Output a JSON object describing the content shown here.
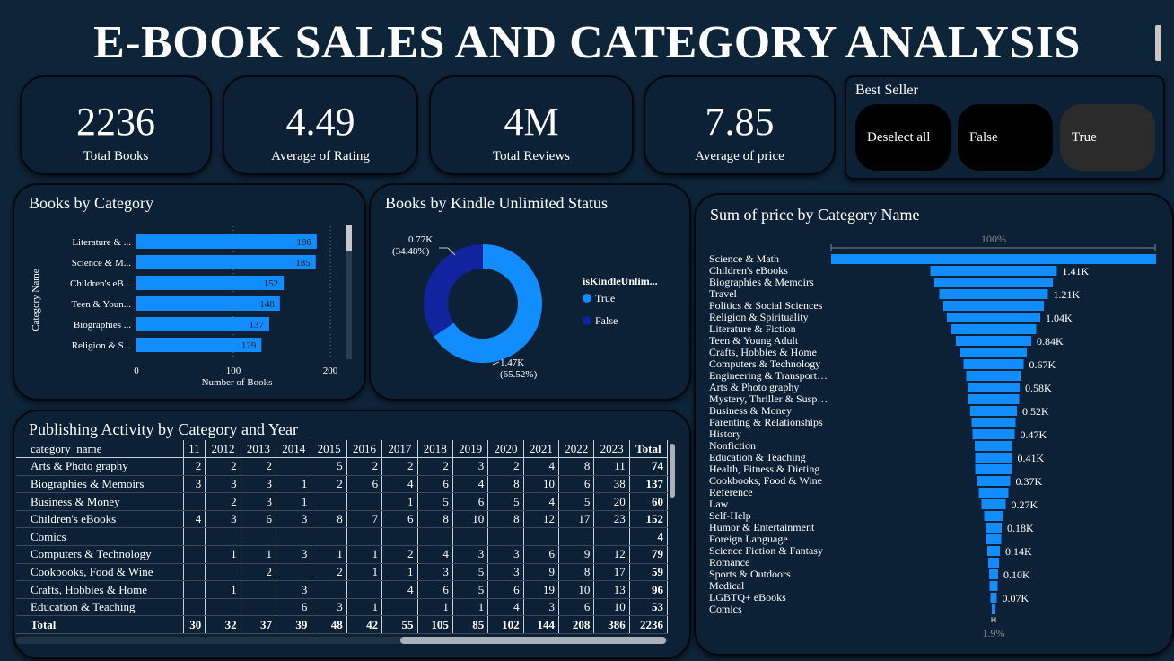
{
  "title": "E-BOOK SALES AND CATEGORY ANALYSIS",
  "kpis": [
    {
      "value": "2236",
      "label": "Total Books"
    },
    {
      "value": "4.49",
      "label": "Average of Rating"
    },
    {
      "value": "4M",
      "label": "Total Reviews"
    },
    {
      "value": "7.85",
      "label": "Average of price"
    }
  ],
  "best_seller": {
    "title": "Best Seller",
    "options": [
      "Deselect all",
      "False",
      "True"
    ],
    "selected": "True"
  },
  "colors": {
    "bar": "#118dff",
    "dark_bar": "#12239e",
    "background": "#0e2438"
  },
  "chart_data": [
    {
      "type": "bar",
      "orientation": "horizontal",
      "title": "Books by Category",
      "xlabel": "Number of Books",
      "ylabel": "Category Name",
      "categories": [
        "Literature & ...",
        "Science & M...",
        "Children's eB...",
        "Teen & Youn...",
        "Biographies ...",
        "Religion & S..."
      ],
      "values": [
        186,
        185,
        152,
        148,
        137,
        129
      ],
      "xticks": [
        "0",
        "100",
        "200"
      ],
      "xlim": [
        0,
        200
      ]
    },
    {
      "type": "pie",
      "donut": true,
      "title": "Books by Kindle Unlimited Status",
      "legend_title": "isKindleUnlim...",
      "slices": [
        {
          "name": "True",
          "value": 1.47,
          "label": "1.47K",
          "pct": "(65.52%)",
          "color": "#118dff"
        },
        {
          "name": "False",
          "value": 0.77,
          "label": "0.77K",
          "pct": "(34.48%)",
          "color": "#12239e"
        }
      ]
    },
    {
      "type": "bar",
      "subtype": "funnel",
      "title": "Sum of price by Category Name",
      "top_label": "100%",
      "bottom_label": "1.9%",
      "categories": [
        "Science & Math",
        "Children's eBooks",
        "Biographies & Memoirs",
        "Travel",
        "Politics & Social Sciences",
        "Religion & Spirituality",
        "Literature & Fiction",
        "Teen & Young Adult",
        "Crafts, Hobbies & Home",
        "Computers & Technology",
        "Engineering & Transport…",
        "Arts & Photo graphy",
        "Mystery, Thriller & Susp…",
        "Business & Money",
        "Parenting & Relationships",
        "History",
        "Nonfiction",
        "Education & Teaching",
        "Health, Fitness & Dieting",
        "Cookbooks, Food & Wine",
        "Reference",
        "Law",
        "Self-Help",
        "Humor & Entertainment",
        "Foreign Language",
        "Science Fiction & Fantasy",
        "Romance",
        "Sports & Outdoors",
        "Medical",
        "LGBTQ+ eBooks",
        "Comics"
      ],
      "values": [
        3.62,
        1.41,
        1.32,
        1.21,
        1.12,
        1.04,
        0.95,
        0.84,
        0.74,
        0.67,
        0.61,
        0.58,
        0.57,
        0.52,
        0.49,
        0.47,
        0.42,
        0.41,
        0.41,
        0.37,
        0.33,
        0.27,
        0.21,
        0.18,
        0.17,
        0.14,
        0.12,
        0.1,
        0.09,
        0.07,
        0.02
      ],
      "data_labels": [
        "",
        "1.41K",
        "",
        "1.21K",
        "",
        "1.04K",
        "",
        "0.84K",
        "",
        "0.67K",
        "",
        "0.58K",
        "",
        "0.52K",
        "",
        "0.47K",
        "",
        "0.41K",
        "",
        "0.37K",
        "",
        "0.27K",
        "",
        "0.18K",
        "",
        "0.14K",
        "",
        "0.10K",
        "",
        "0.07K",
        ""
      ]
    },
    {
      "type": "table",
      "title": "Publishing Activity by Category and Year",
      "columns": [
        "category_name",
        "11",
        "2012",
        "2013",
        "2014",
        "2015",
        "2016",
        "2017",
        "2018",
        "2019",
        "2020",
        "2021",
        "2022",
        "2023",
        "Total"
      ],
      "rows": [
        [
          "Arts & Photo graphy",
          "2",
          "2",
          "2",
          "",
          "5",
          "2",
          "2",
          "2",
          "3",
          "2",
          "4",
          "8",
          "11",
          "74"
        ],
        [
          "Biographies & Memoirs",
          "3",
          "3",
          "3",
          "1",
          "2",
          "6",
          "4",
          "6",
          "4",
          "8",
          "10",
          "6",
          "38",
          "137"
        ],
        [
          "Business & Money",
          "",
          "2",
          "3",
          "1",
          "",
          "",
          "1",
          "5",
          "6",
          "5",
          "4",
          "5",
          "20",
          "60"
        ],
        [
          "Children's eBooks",
          "4",
          "3",
          "6",
          "3",
          "8",
          "7",
          "6",
          "8",
          "10",
          "8",
          "12",
          "17",
          "23",
          "152"
        ],
        [
          "Comics",
          "",
          "",
          "",
          "",
          "",
          "",
          "",
          "",
          "",
          "",
          "",
          "",
          "",
          "4"
        ],
        [
          "Computers & Technology",
          "",
          "1",
          "1",
          "3",
          "1",
          "1",
          "2",
          "4",
          "3",
          "3",
          "6",
          "9",
          "12",
          "79"
        ],
        [
          "Cookbooks, Food & Wine",
          "",
          "",
          "2",
          "",
          "2",
          "1",
          "1",
          "3",
          "5",
          "3",
          "9",
          "8",
          "17",
          "59"
        ],
        [
          "Crafts, Hobbies & Home",
          "",
          "1",
          "",
          "3",
          "",
          "",
          "4",
          "6",
          "5",
          "6",
          "19",
          "10",
          "13",
          "96"
        ],
        [
          "Education & Teaching",
          "",
          "",
          "",
          "6",
          "3",
          "1",
          "",
          "1",
          "1",
          "4",
          "3",
          "6",
          "10",
          "53"
        ]
      ],
      "total_row": [
        "Total",
        "30",
        "32",
        "37",
        "39",
        "48",
        "42",
        "55",
        "105",
        "85",
        "102",
        "144",
        "208",
        "386",
        "2236"
      ]
    }
  ]
}
